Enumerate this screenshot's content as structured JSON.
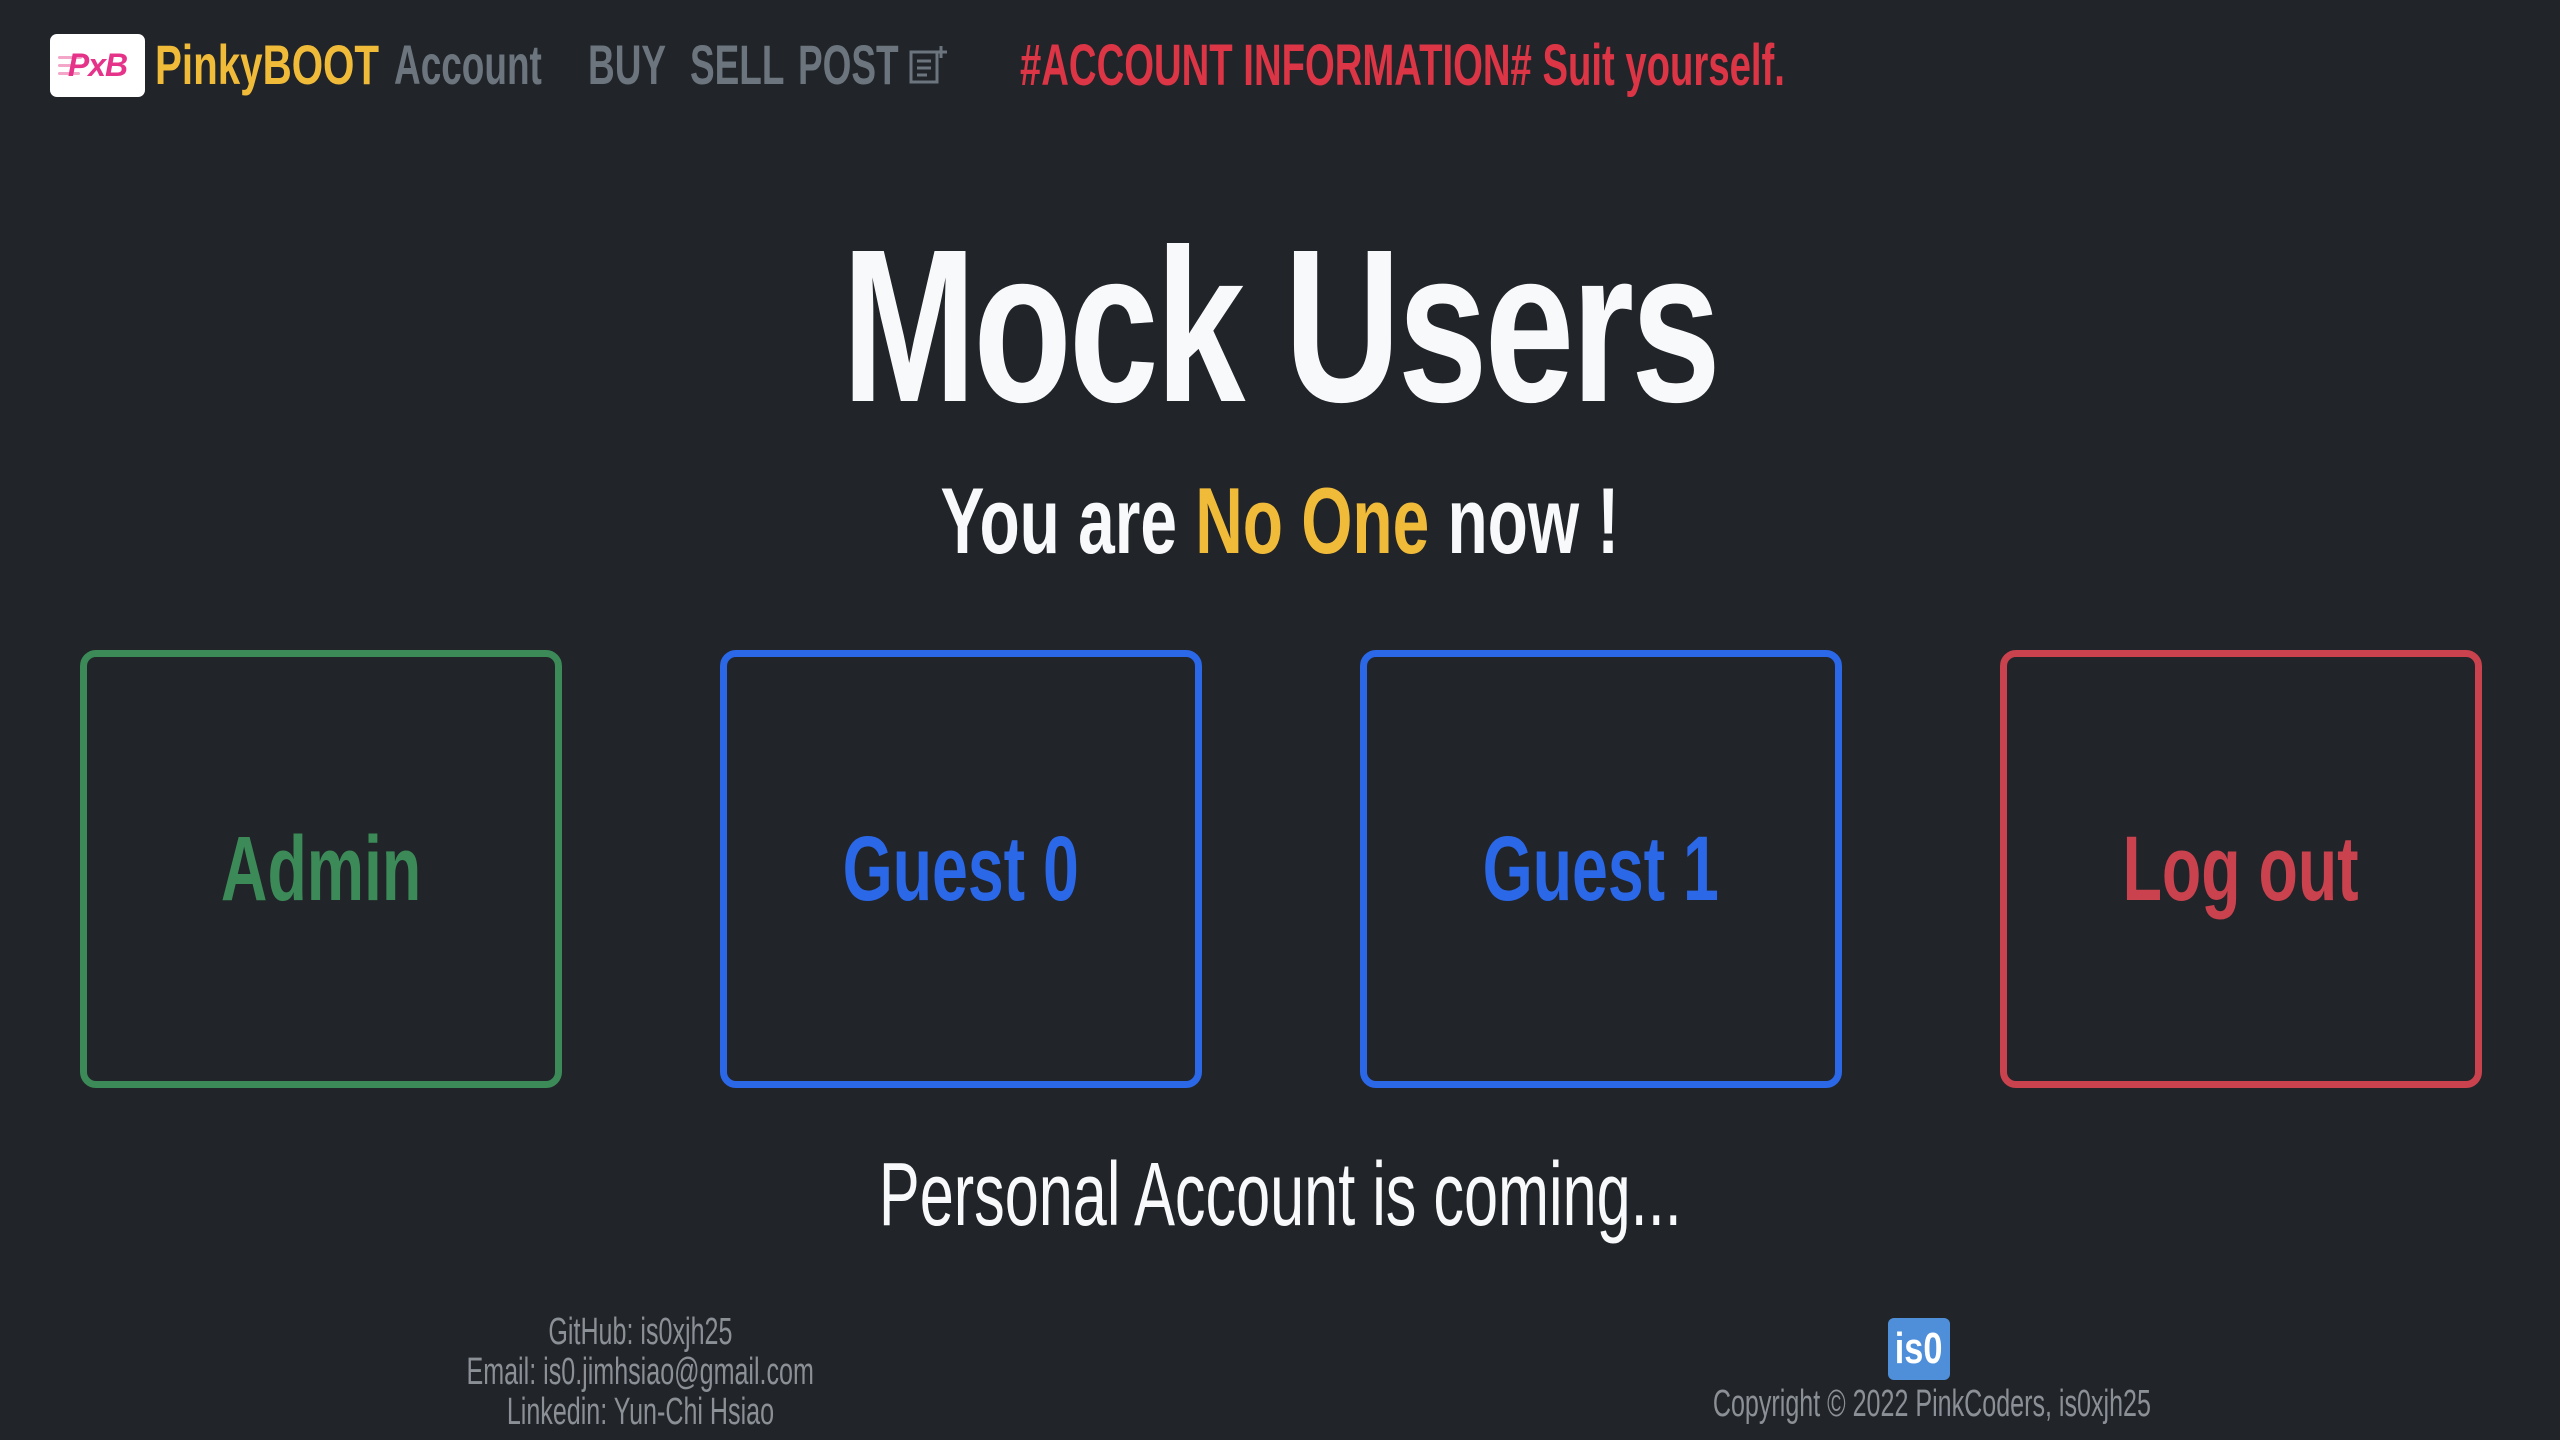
{
  "navbar": {
    "logo_text": "PxB",
    "brand": "PinkyBOOT",
    "links": [
      "Account",
      "BUY",
      "SELL",
      "POST"
    ],
    "banner": "#ACCOUNT INFORMATION# Suit yourself."
  },
  "hero": {
    "title": "Mock Users",
    "status_prefix": "You are ",
    "status_user": "No One",
    "status_suffix": " now !"
  },
  "accounts": [
    "Admin",
    "Guest 0",
    "Guest 1",
    "Log out"
  ],
  "notice": "Personal Account is coming...",
  "footer": {
    "github": "GitHub: is0xjh25",
    "email": "Email: is0.jimhsiao@gmail.com",
    "linkedin": "Linkedin: Yun-Chi Hsiao",
    "badge": "is0",
    "copyright": "Copyright © 2022 PinkCoders, is0xjh25"
  },
  "colors": {
    "background": "#212429",
    "brand_yellow": "#f1bb3a",
    "nav_gray": "#6c757d",
    "banner_red": "#dc3545",
    "admin_green": "#3b8a57",
    "guest_blue": "#2a68e8",
    "logout_red": "#c9424e",
    "footer_gray": "#8b9096"
  },
  "icons": {
    "post": "post-add-icon",
    "logo": "pxb-logo"
  }
}
